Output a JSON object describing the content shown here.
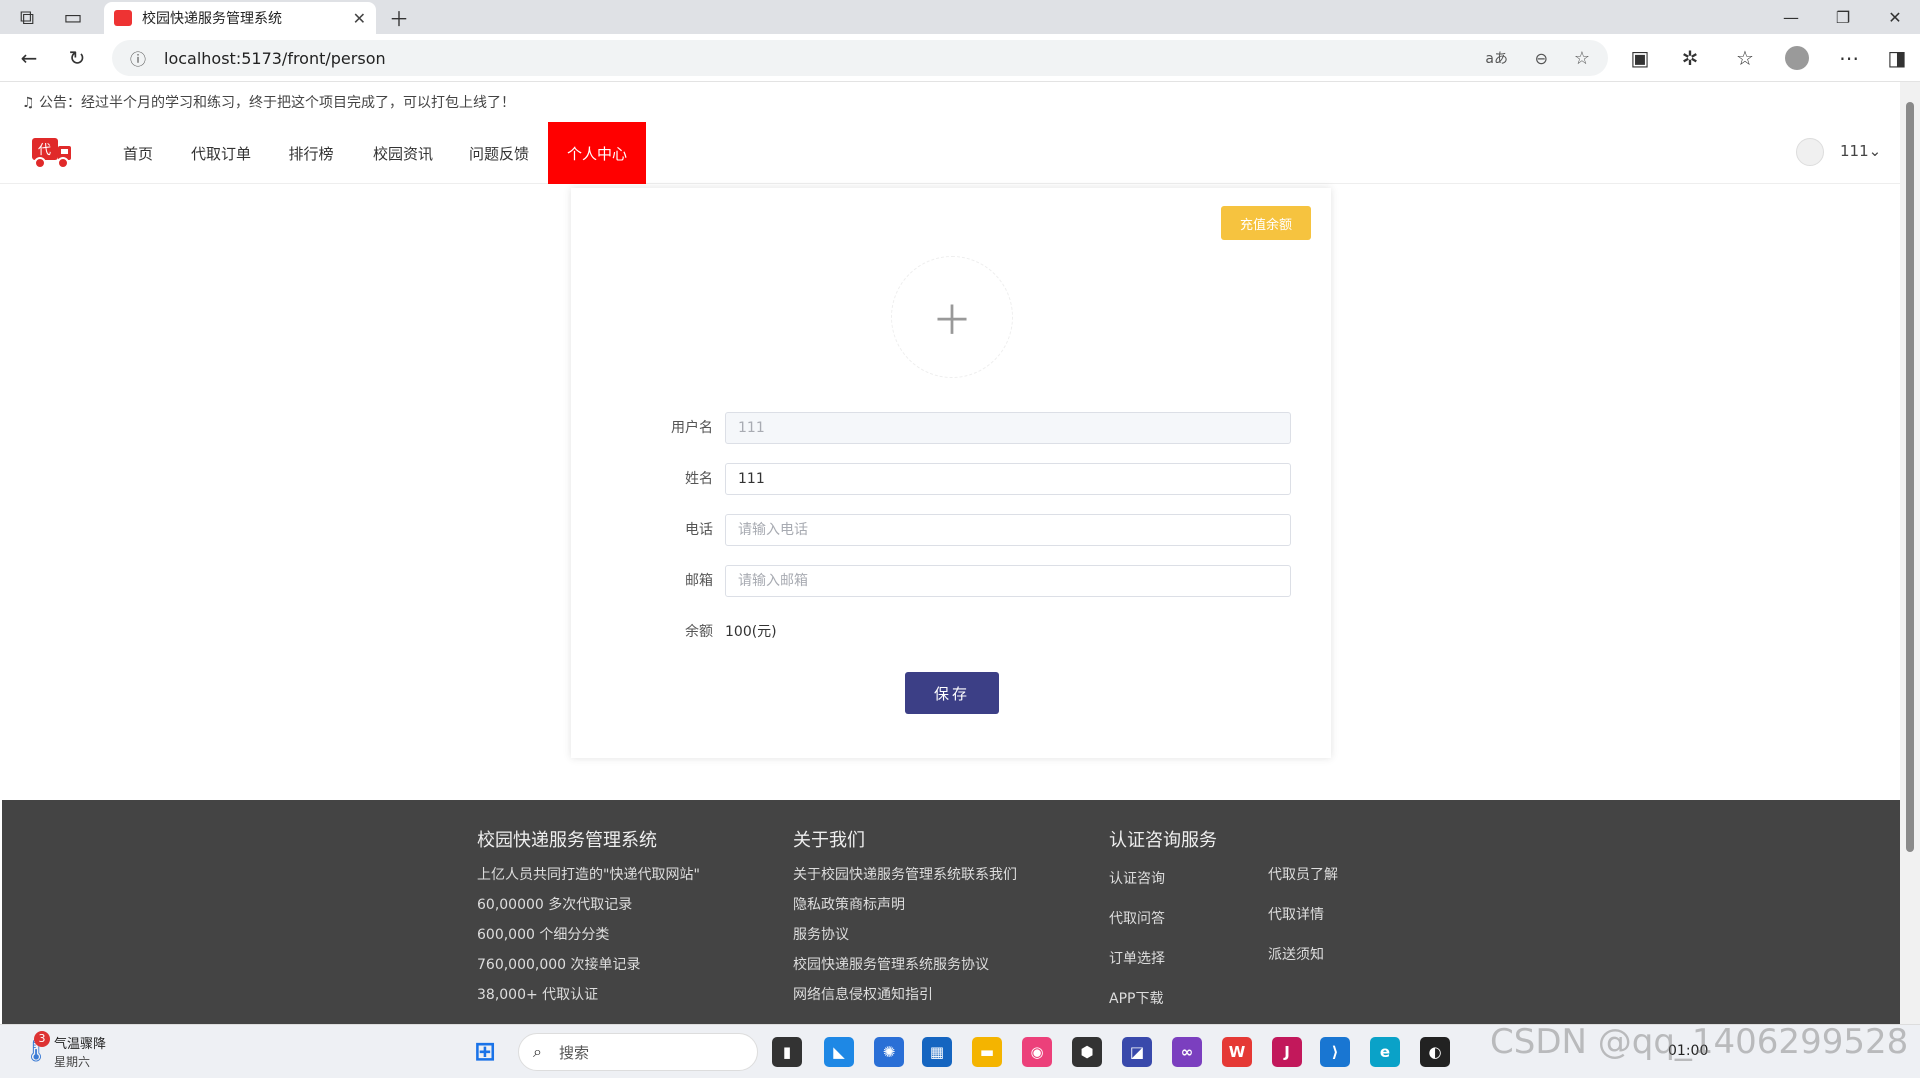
{
  "browser": {
    "tab_title": "校园快递服务管理系统",
    "url": "localhost:5173/front/person",
    "translate_icon_text": "aあ"
  },
  "notice": "公告：经过半个月的学习和练习，终于把这个项目完成了，可以打包上线了！",
  "nav": {
    "items": [
      "首页",
      "代取订单",
      "排行榜",
      "校园资讯",
      "问题反馈",
      "个人中心"
    ],
    "active_index": 5,
    "active_color": "#ff0000",
    "username": "111"
  },
  "profile": {
    "recharge_label": "充值余额",
    "recharge_color": "#f6c33f",
    "fields": [
      {
        "label": "用户名",
        "value": "111",
        "placeholder": "",
        "disabled": true
      },
      {
        "label": "姓名",
        "value": "111",
        "placeholder": "",
        "disabled": false
      },
      {
        "label": "电话",
        "value": "",
        "placeholder": "请输入电话",
        "disabled": false
      },
      {
        "label": "邮箱",
        "value": "",
        "placeholder": "请输入邮箱",
        "disabled": false
      }
    ],
    "balance_label": "余额",
    "balance_value": "100(元)",
    "save_label": "保存",
    "save_color": "#3c3f86"
  },
  "footer": {
    "col1": {
      "title": "校园快递服务管理系统",
      "links": [
        "上亿人员共同打造的\"快递代取网站\"",
        "60,00000 多次代取记录",
        "600,000 个细分分类",
        "760,000,000 次接单记录",
        "38,000+ 代取认证"
      ]
    },
    "col2": {
      "title": "关于我们",
      "links": [
        "关于校园快递服务管理系统联系我们",
        "隐私政策商标声明",
        "服务协议",
        "校园快递服务管理系统服务协议",
        "网络信息侵权通知指引"
      ]
    },
    "col3": {
      "title": "认证咨询服务",
      "links_a": [
        "认证咨询",
        "代取问答",
        "订单选择",
        "APP下载"
      ],
      "links_b": [
        "代取员了解",
        "代取详情",
        "派送须知"
      ]
    }
  },
  "taskbar": {
    "weather_badge": "3",
    "weather_text": "气温骤降",
    "weekday": "星期六",
    "search_placeholder": "搜索",
    "time": "01:00",
    "watermark": "CSDN @qq_1406299528"
  }
}
